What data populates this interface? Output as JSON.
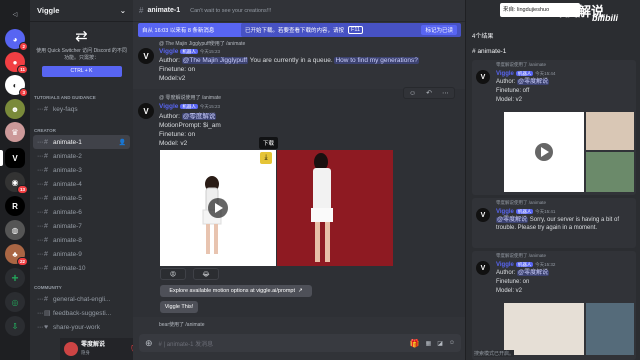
{
  "app": {
    "server_name": "Viggle",
    "watermark": "零度解说",
    "watermark_brand": "bilibili"
  },
  "servers": {
    "badges": [
      "2",
      "11",
      "3",
      "1",
      "13",
      "4",
      "22"
    ]
  },
  "sidebar": {
    "tip_text": "使用 Quick Switcher 访问 Discord 的不同功能。只需按：",
    "tip_shortcut": "CTRL + K",
    "sections": [
      {
        "label": "TUTORIALS AND GUIDANCE",
        "items": [
          {
            "label": "key-faqs",
            "active": false
          }
        ]
      },
      {
        "label": "CREATOR",
        "items": [
          {
            "label": "animate-1",
            "active": true
          },
          {
            "label": "animate-2",
            "active": false
          },
          {
            "label": "animate-3",
            "active": false
          },
          {
            "label": "animate-4",
            "active": false
          },
          {
            "label": "animate-5",
            "active": false
          },
          {
            "label": "animate-6",
            "active": false
          },
          {
            "label": "animate-7",
            "active": false
          },
          {
            "label": "animate-8",
            "active": false
          },
          {
            "label": "animate-9",
            "active": false
          },
          {
            "label": "animate-10",
            "active": false
          }
        ]
      },
      {
        "label": "COMMUNITY",
        "items": [
          {
            "label": "general-chat-engli...",
            "active": false
          },
          {
            "label": "feedback-suggesti...",
            "active": false
          },
          {
            "label": "share-your-work",
            "active": false
          }
        ]
      }
    ],
    "user": {
      "name": "零度解说",
      "status": "隐身"
    }
  },
  "header": {
    "channel": "animate-1",
    "topic": "Can't wait to see your creations!!!",
    "download_hint": "已开始下载。若要查看下载的内容，请按",
    "key": "F11",
    "mark_read": "标记为已读",
    "search_value": "来自: lingdujieshuo"
  },
  "notice": {
    "text": "自从 16:03 以来有 8 条新消息"
  },
  "messages": [
    {
      "reply": "@ The Majin Jigglypuff使用了 /animate",
      "author": "Viggle",
      "bot": "机器人",
      "time": "今天15:23",
      "line1_prefix": "Author: ",
      "line1_mention": "@The Majin Jigglypuff",
      "line1_suffix": " You are currently in a queue.",
      "line1_link": "How to find my generations?",
      "line2": "Finetune: on",
      "line3": "Model:v2"
    },
    {
      "reply": "@ 零度解说使用了 /animate",
      "author": "Viggle",
      "bot": "机器人",
      "time": "今天15:23",
      "line1_prefix": "Author: ",
      "line1_mention": "@零度解说",
      "line2": "MotionPrompt: $i_am",
      "line3": "Finetune: on",
      "line4": "Model: v2",
      "tooltip": "下载",
      "reactions": [
        "😡",
        "😂"
      ],
      "explore": "Explore available motion options at viggle.ai/prompt",
      "button": "Viggle This!"
    }
  ],
  "composer": {
    "typing": "bear使用了 /animate",
    "placeholder": "# | animate-1 发消息"
  },
  "right": {
    "title": "4个结果",
    "channel": "animate-1",
    "results": [
      {
        "author": "Viggle",
        "bot": "机器人",
        "time": "今天15:44",
        "line1": "Author: ",
        "mention": "@零度解说",
        "line2": "Finetune: off",
        "line3": "Model: v2"
      },
      {
        "author": "Viggle",
        "bot": "机器人",
        "time": "今天15:41",
        "line1": "",
        "mention": "@零度解说",
        "text": " Sorry, our server is having a bit of trouble. Please try again in a moment."
      },
      {
        "author": "Viggle",
        "bot": "机器人",
        "time": "今天15:32",
        "line1": "Author: ",
        "mention": "@零度解说",
        "line2": "Finetune: on",
        "line3": "Model: v2"
      }
    ],
    "reply_labels": [
      "零度解说使用了 /animate",
      "零度解说使用了 /animate",
      "零度解说使用了 /animate"
    ],
    "footer": "搜索模式已开启。"
  },
  "colors": {
    "accent": "#5865f2",
    "red": "#f23f43"
  }
}
